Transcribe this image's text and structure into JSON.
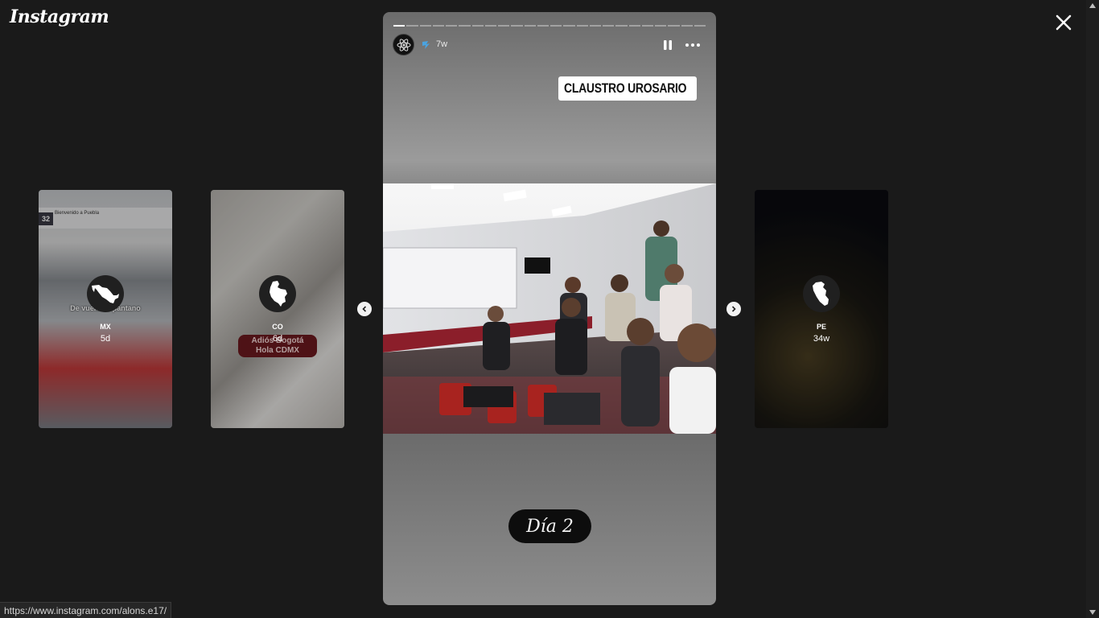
{
  "app": {
    "logo_text": "Instagram"
  },
  "previews": [
    {
      "id": "mx",
      "name": "MX",
      "time": "5d",
      "overlay_text": "De vuelta al pantano",
      "sign_text": "Bienvenido a Puebla",
      "sign_number": "32"
    },
    {
      "id": "co",
      "name": "CO",
      "time": "6d",
      "caption_line1": "Adiós Bogotá",
      "caption_line2": "Hola CDMX"
    },
    {
      "id": "pe",
      "name": "PE",
      "time": "34w"
    }
  ],
  "story": {
    "time": "7w",
    "progress": {
      "segments": 24,
      "active_index": 0
    },
    "location_sticker": "CLAUSTRO UROSARIO",
    "day_sticker": "Día 2"
  },
  "status_bar": {
    "url": "https://www.instagram.com/alons.e17/"
  },
  "colors": {
    "background": "#1a1a1a",
    "caption_bg": "#6d1a1f"
  },
  "icons": [
    "close-icon",
    "pause-icon",
    "more-icon",
    "chevron-left-icon",
    "chevron-right-icon",
    "atom-icon",
    "verified-badge-icon",
    "map-mexico-icon",
    "map-colombia-icon",
    "map-peru-icon",
    "location-pin-icon"
  ]
}
